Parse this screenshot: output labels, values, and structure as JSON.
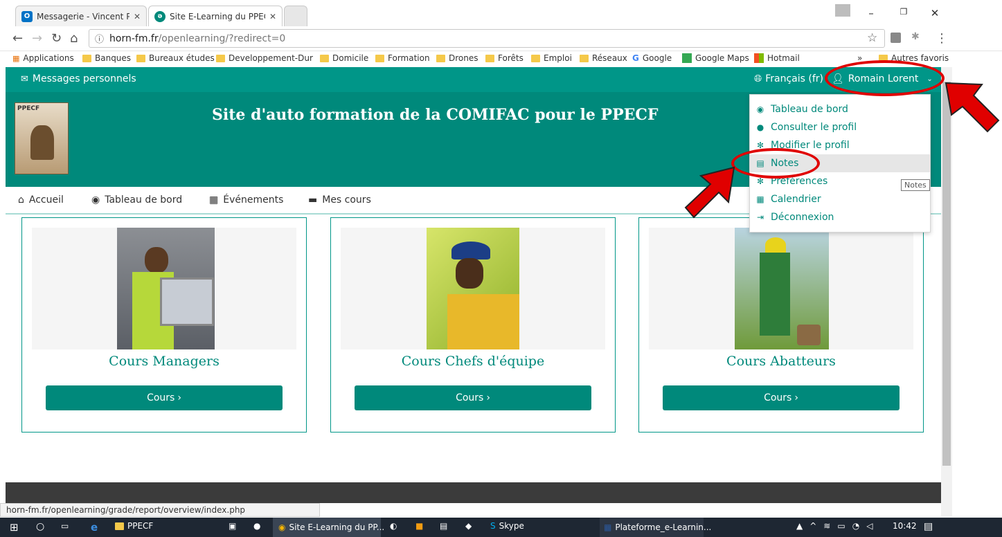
{
  "browser": {
    "tabs": [
      {
        "title": "Messagerie - Vincent Pel",
        "favicon": "outlook-icon",
        "active": false
      },
      {
        "title": "Site E-Learning du PPECF",
        "favicon": "moodle-icon",
        "active": true
      }
    ],
    "url_host": "horn-fm.fr",
    "url_path": "/openlearning/?redirect=0",
    "bookmarks": [
      "Applications",
      "Banques",
      "Bureaux études",
      "Developpement-Dura",
      "Domicile",
      "Formation",
      "Drones",
      "Forêts",
      "Emploi",
      "Réseaux",
      "Google",
      "Google Maps",
      "Hotmail"
    ],
    "bookmarks_more": "»",
    "other_bookmarks": "Autres favoris",
    "status_url": "horn-fm.fr/openlearning/grade/report/overview/index.php"
  },
  "topnav": {
    "messages": "Messages personnels",
    "language": "Français (fr)",
    "user": "Romain Lorent"
  },
  "header": {
    "logo_text": "PPECF",
    "title": "Site d'auto formation de la COMIFAC pour le PPECF"
  },
  "menu": [
    {
      "label": "Accueil",
      "icon": "home-icon"
    },
    {
      "label": "Tableau de bord",
      "icon": "dashboard-icon"
    },
    {
      "label": "Événements",
      "icon": "calendar-icon"
    },
    {
      "label": "Mes cours",
      "icon": "briefcase-icon"
    }
  ],
  "user_menu": [
    {
      "label": "Tableau de bord",
      "icon": "dashboard-icon"
    },
    {
      "label": "Consulter le profil",
      "icon": "user-icon"
    },
    {
      "label": "Modifier le profil",
      "icon": "cog-icon"
    },
    {
      "label": "Notes",
      "icon": "table-icon",
      "highlighted": true
    },
    {
      "label": "Préférences",
      "icon": "wrench-icon"
    },
    {
      "label": "Calendrier",
      "icon": "calendar-icon"
    },
    {
      "label": "Déconnexion",
      "icon": "sign-out-icon"
    }
  ],
  "tooltip": "Notes",
  "courses": [
    {
      "title": "Cours Managers",
      "button": "Cours"
    },
    {
      "title": "Cours Chefs d'équipe",
      "button": "Cours"
    },
    {
      "title": "Cours Abatteurs",
      "button": "Cours"
    }
  ],
  "taskbar": {
    "items": [
      "PPECF",
      "Site E-Learning du PP...",
      "Skype",
      "Plateforme_e-Learnin..."
    ],
    "time": "10:42"
  },
  "colors": {
    "primary": "#00897b",
    "annotation": "#e00000"
  }
}
